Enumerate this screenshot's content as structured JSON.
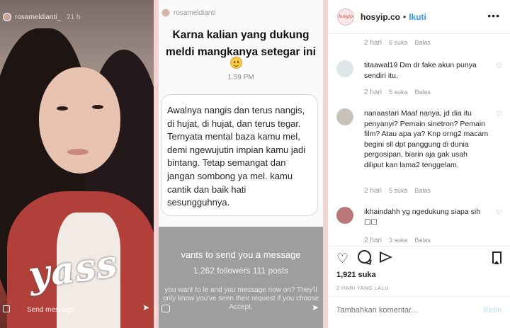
{
  "story_left": {
    "username": "rosameldianti_",
    "time": "21 h",
    "sticker": "yass",
    "send_message": "Send message"
  },
  "story_right": {
    "username": "rosameldianti",
    "headline": "Karna kalian yang dukung meldi mangkanya setegar ini",
    "emoji": "smile-emoji",
    "time": "1.59 PM",
    "message": "Awalnya nangis dan terus nangis, di hujat, di hujat, dan terus tegar. Ternyata mental baza kamu mel, demi ngewujutin impian kamu jadi bintang. Tetap semangat dan jangan sombong ya mel. kamu cantik dan baik hati sesungguhnya.",
    "request_line": "vants to send you a message",
    "followers": "1.262 followers 111 posts",
    "request_info": "you want to le                  and you message now on? They'll only know you've seen their request if you choose Accept."
  },
  "header": {
    "avatar_text": "hosyip",
    "handle": "hosyip.co",
    "separator": "•",
    "follow": "Ikuti",
    "more": "•••"
  },
  "comments": [
    {
      "meta": {
        "time": "2 hari",
        "likes": "6 suka",
        "reply": "Balas"
      }
    },
    {
      "user": "titaawal19",
      "text": "Dm dr fake akun punya sendiri itu.",
      "meta": {
        "time": "2 hari",
        "likes": "5 suka",
        "reply": "Balas"
      }
    },
    {
      "user": "nanaastari",
      "text": "Maaf nanya, jd dia itu penyanyi? Pemain sinetron? Pemain film? Atau apa ya? Knp orng2 macam begini sll dpt panggung di dunia pergosipan, biarin aja gak usah diliput kan lama2 tenggelam.",
      "meta": {
        "time": "2 hari",
        "likes": "5 suka",
        "reply": "Balas"
      }
    },
    {
      "user": "ikhaindahh",
      "text": "yg ngedukung siapa sih ☐☐",
      "meta": {
        "time": "2 hari",
        "likes": "3 suka",
        "reply": "Balas"
      }
    }
  ],
  "post": {
    "likes": "1,921 suka",
    "date": "2 HARI YANG LALU",
    "add_comment_placeholder": "Tambahkan komentar...",
    "post_button": "Kirim"
  },
  "colors": {
    "accent": "#3897f0",
    "frame_pink": "#f3d3d6"
  }
}
